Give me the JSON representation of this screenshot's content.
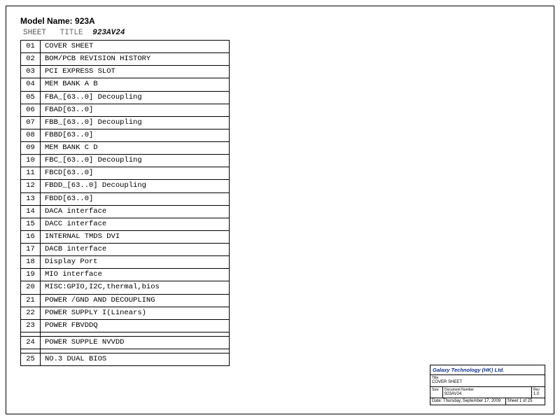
{
  "model": {
    "label": "Model Name:",
    "value": "923A"
  },
  "columns": {
    "sheet": "SHEET",
    "title_label": "TITLE",
    "title_value": "923AV24"
  },
  "toc": [
    {
      "num": "01",
      "title": "COVER SHEET"
    },
    {
      "num": "02",
      "title": "BOM/PCB REVISION HISTORY"
    },
    {
      "num": "03",
      "title": "PCI EXPRESS SLOT"
    },
    {
      "num": "04",
      "title": "MEM BANK A B"
    },
    {
      "num": "05",
      "title": "FBA_[63..0] Decoupling"
    },
    {
      "num": "06",
      "title": "FBAD[63..0]"
    },
    {
      "num": "07",
      "title": "FBB_[63..0] Decoupling"
    },
    {
      "num": "08",
      "title": "FBBD[63..0]"
    },
    {
      "num": "09",
      "title": "MEM BANK C D"
    },
    {
      "num": "10",
      "title": "FBC_[63..0] Decoupling"
    },
    {
      "num": "11",
      "title": "FBCD[63..0]"
    },
    {
      "num": "12",
      "title": "FBDD_[63..0] Decoupling"
    },
    {
      "num": "13",
      "title": "FBDD[63..0]"
    },
    {
      "num": "14",
      "title": "DACA interface"
    },
    {
      "num": "15",
      "title": "DACC interface"
    },
    {
      "num": "16",
      "title": "INTERNAL TMDS DVI"
    },
    {
      "num": "17",
      "title": "DACB interface"
    },
    {
      "num": "18",
      "title": "Display Port"
    },
    {
      "num": "19",
      "title": "MIO interface"
    },
    {
      "num": "20",
      "title": "MISC:GPIO,I2C,thermal,bios"
    },
    {
      "num": "21",
      "title": "POWER /GND AND DECOUPLING"
    },
    {
      "num": "22",
      "title": "POWER SUPPLY I(Linears)"
    },
    {
      "num": "23",
      "title": "POWER FBVDDQ"
    },
    {
      "num": "24",
      "title": "POWER SUPPLE NVVDD"
    },
    {
      "num": "25",
      "title": "NO.3 DUAL BIOS"
    }
  ],
  "titleblock": {
    "company": "Galaxy Technology (HK) Ltd.",
    "title_label": "Title",
    "title": "COVER SHEET",
    "size_label": "Size",
    "size": "",
    "docno_label": "Document Number",
    "docno": "923AV24",
    "rev_label": "Rev",
    "rev": "1.0",
    "date_label": "Date:",
    "date": "Thursday, September 17, 2009",
    "sheet_label": "Sheet",
    "sheet": "1",
    "of_label": "of",
    "of": "25"
  }
}
